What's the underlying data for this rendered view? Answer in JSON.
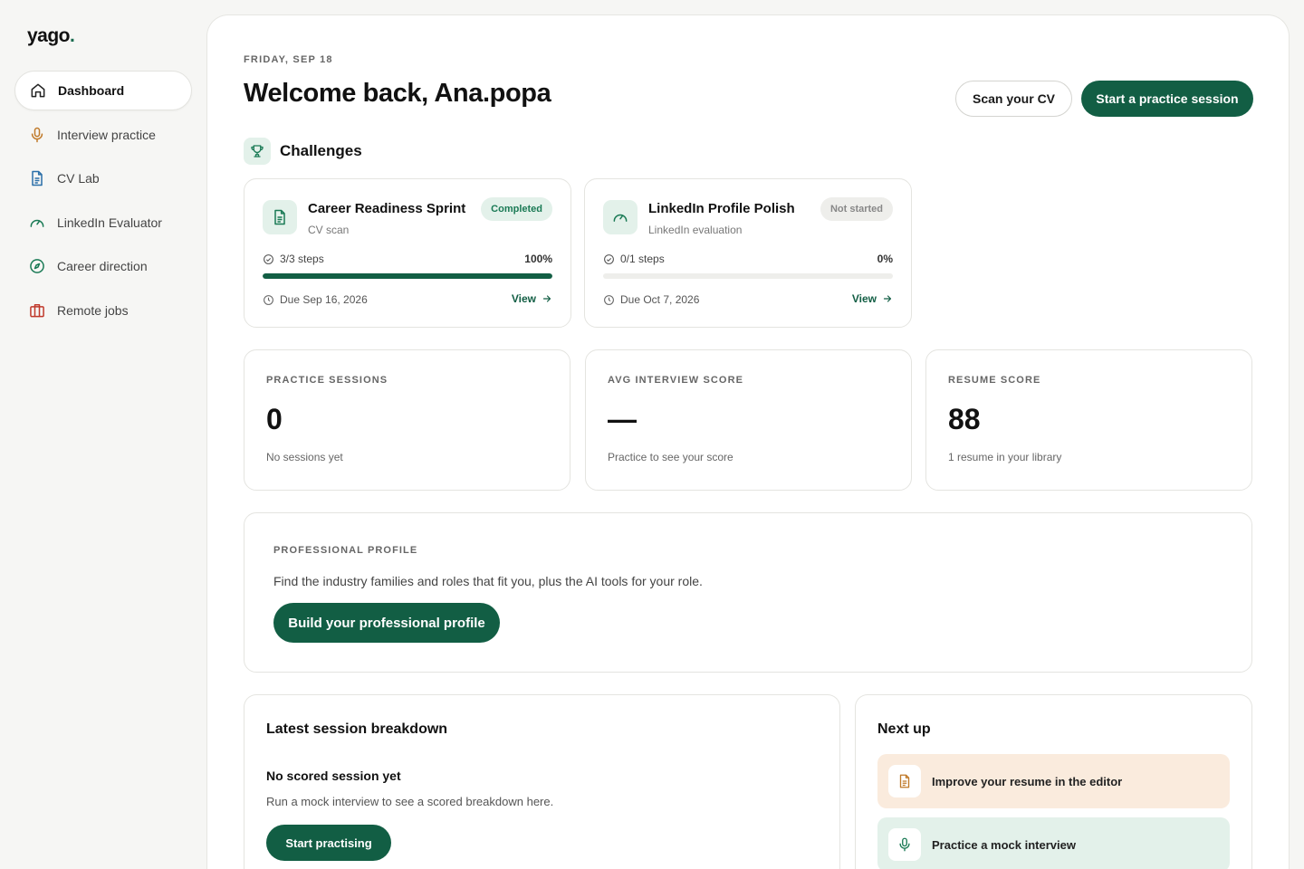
{
  "brand": {
    "name": "yago",
    "dot": "."
  },
  "sidebar": {
    "items": [
      {
        "label": "Dashboard",
        "icon": "home-icon",
        "active": true
      },
      {
        "label": "Interview practice",
        "icon": "microphone-icon"
      },
      {
        "label": "CV Lab",
        "icon": "document-icon"
      },
      {
        "label": "LinkedIn Evaluator",
        "icon": "gauge-icon"
      },
      {
        "label": "Career direction",
        "icon": "compass-icon"
      },
      {
        "label": "Remote jobs",
        "icon": "briefcase-icon"
      }
    ]
  },
  "header": {
    "date": "FRIDAY, SEP 18",
    "welcome": "Welcome back, Ana.popa",
    "scan_cv_label": "Scan your CV",
    "start_session_label": "Start a practice session"
  },
  "challenges": {
    "title": "Challenges",
    "items": [
      {
        "title": "Career Readiness Sprint",
        "subtitle": "CV scan",
        "badge": "Completed",
        "steps": "3/3 steps",
        "percent": "100%",
        "progress": 1.0,
        "due": "Due Sep 16, 2026",
        "view_label": "View"
      },
      {
        "title": "LinkedIn Profile Polish",
        "subtitle": "LinkedIn evaluation",
        "badge": "Not started",
        "steps": "0/1 steps",
        "percent": "0%",
        "progress": 0.0,
        "due": "Due Oct 7, 2026",
        "view_label": "View"
      }
    ]
  },
  "stats": [
    {
      "label": "PRACTICE SESSIONS",
      "value": "0",
      "note": "No sessions yet"
    },
    {
      "label": "AVG INTERVIEW SCORE",
      "value": "—",
      "note": "Practice to see your score"
    },
    {
      "label": "RESUME SCORE",
      "value": "88",
      "note": "1 resume in your library"
    }
  ],
  "profile": {
    "label": "PROFESSIONAL PROFILE",
    "text": "Find the industry families and roles that fit you, plus the AI tools for your role.",
    "button_label": "Build your professional profile"
  },
  "breakdown": {
    "title": "Latest session breakdown",
    "heading": "No scored session yet",
    "text": "Run a mock interview to see a scored breakdown here.",
    "button_label": "Start practising"
  },
  "next_up": {
    "title": "Next up",
    "items": [
      {
        "label": "Improve your resume in the editor",
        "icon": "document-icon"
      },
      {
        "label": "Practice a mock interview",
        "icon": "microphone-icon"
      }
    ]
  },
  "colors": {
    "primary": "#125e44",
    "mint": "#e3f1ea",
    "peach": "#faebdd"
  }
}
